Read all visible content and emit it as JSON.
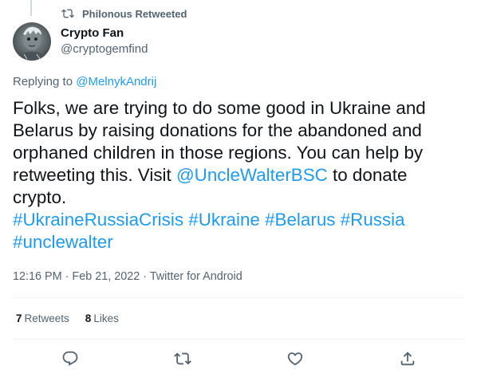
{
  "retweet_context": {
    "label": "Philonous Retweeted",
    "icon": "retweet-icon"
  },
  "author": {
    "display_name": "Crypto Fan",
    "handle": "@cryptogemfind",
    "avatar_icon": "avatar-portrait"
  },
  "replying": {
    "prefix": "Replying to ",
    "mention": "@MelnykAndrij"
  },
  "tweet": {
    "text_part1": "Folks, we are trying to do some good in Ukraine and Belarus by raising donations for the abandoned and orphaned children in those regions. You can help by retweeting this. Visit ",
    "mention": "@UncleWalterBSC",
    "text_part2": " to donate crypto.",
    "hashtags": [
      "#UkraineRussiaCrisis",
      "#Ukraine",
      "#Belarus",
      "#Russia",
      "#unclewalter"
    ]
  },
  "meta": {
    "time": "12:16 PM",
    "separator1": " · ",
    "date": "Feb 21, 2022",
    "separator2": " · ",
    "source": "Twitter for Android"
  },
  "stats": {
    "retweets_count": "7",
    "retweets_label": "Retweets",
    "likes_count": "8",
    "likes_label": "Likes"
  },
  "actions": [
    {
      "icon": "reply-icon"
    },
    {
      "icon": "retweet-icon"
    },
    {
      "icon": "like-icon"
    },
    {
      "icon": "share-icon"
    }
  ],
  "colors": {
    "link": "#1d9bf0",
    "secondary_text": "#536471",
    "primary_text": "#0f1419",
    "divider": "#eff3f4"
  }
}
